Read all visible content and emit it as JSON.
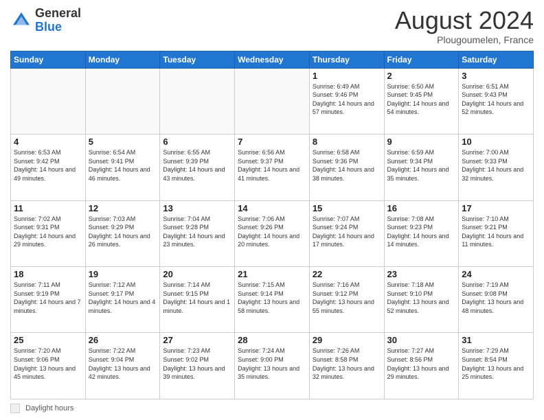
{
  "header": {
    "logo_general": "General",
    "logo_blue": "Blue",
    "month_title": "August 2024",
    "location": "Plougoumelen, France"
  },
  "legend": {
    "box_label": "Daylight hours"
  },
  "days_of_week": [
    "Sunday",
    "Monday",
    "Tuesday",
    "Wednesday",
    "Thursday",
    "Friday",
    "Saturday"
  ],
  "weeks": [
    [
      {
        "day": "",
        "info": ""
      },
      {
        "day": "",
        "info": ""
      },
      {
        "day": "",
        "info": ""
      },
      {
        "day": "",
        "info": ""
      },
      {
        "day": "1",
        "info": "Sunrise: 6:49 AM\nSunset: 9:46 PM\nDaylight: 14 hours\nand 57 minutes."
      },
      {
        "day": "2",
        "info": "Sunrise: 6:50 AM\nSunset: 9:45 PM\nDaylight: 14 hours\nand 54 minutes."
      },
      {
        "day": "3",
        "info": "Sunrise: 6:51 AM\nSunset: 9:43 PM\nDaylight: 14 hours\nand 52 minutes."
      }
    ],
    [
      {
        "day": "4",
        "info": "Sunrise: 6:53 AM\nSunset: 9:42 PM\nDaylight: 14 hours\nand 49 minutes."
      },
      {
        "day": "5",
        "info": "Sunrise: 6:54 AM\nSunset: 9:41 PM\nDaylight: 14 hours\nand 46 minutes."
      },
      {
        "day": "6",
        "info": "Sunrise: 6:55 AM\nSunset: 9:39 PM\nDaylight: 14 hours\nand 43 minutes."
      },
      {
        "day": "7",
        "info": "Sunrise: 6:56 AM\nSunset: 9:37 PM\nDaylight: 14 hours\nand 41 minutes."
      },
      {
        "day": "8",
        "info": "Sunrise: 6:58 AM\nSunset: 9:36 PM\nDaylight: 14 hours\nand 38 minutes."
      },
      {
        "day": "9",
        "info": "Sunrise: 6:59 AM\nSunset: 9:34 PM\nDaylight: 14 hours\nand 35 minutes."
      },
      {
        "day": "10",
        "info": "Sunrise: 7:00 AM\nSunset: 9:33 PM\nDaylight: 14 hours\nand 32 minutes."
      }
    ],
    [
      {
        "day": "11",
        "info": "Sunrise: 7:02 AM\nSunset: 9:31 PM\nDaylight: 14 hours\nand 29 minutes."
      },
      {
        "day": "12",
        "info": "Sunrise: 7:03 AM\nSunset: 9:29 PM\nDaylight: 14 hours\nand 26 minutes."
      },
      {
        "day": "13",
        "info": "Sunrise: 7:04 AM\nSunset: 9:28 PM\nDaylight: 14 hours\nand 23 minutes."
      },
      {
        "day": "14",
        "info": "Sunrise: 7:06 AM\nSunset: 9:26 PM\nDaylight: 14 hours\nand 20 minutes."
      },
      {
        "day": "15",
        "info": "Sunrise: 7:07 AM\nSunset: 9:24 PM\nDaylight: 14 hours\nand 17 minutes."
      },
      {
        "day": "16",
        "info": "Sunrise: 7:08 AM\nSunset: 9:23 PM\nDaylight: 14 hours\nand 14 minutes."
      },
      {
        "day": "17",
        "info": "Sunrise: 7:10 AM\nSunset: 9:21 PM\nDaylight: 14 hours\nand 11 minutes."
      }
    ],
    [
      {
        "day": "18",
        "info": "Sunrise: 7:11 AM\nSunset: 9:19 PM\nDaylight: 14 hours\nand 7 minutes."
      },
      {
        "day": "19",
        "info": "Sunrise: 7:12 AM\nSunset: 9:17 PM\nDaylight: 14 hours\nand 4 minutes."
      },
      {
        "day": "20",
        "info": "Sunrise: 7:14 AM\nSunset: 9:15 PM\nDaylight: 14 hours\nand 1 minute."
      },
      {
        "day": "21",
        "info": "Sunrise: 7:15 AM\nSunset: 9:14 PM\nDaylight: 13 hours\nand 58 minutes."
      },
      {
        "day": "22",
        "info": "Sunrise: 7:16 AM\nSunset: 9:12 PM\nDaylight: 13 hours\nand 55 minutes."
      },
      {
        "day": "23",
        "info": "Sunrise: 7:18 AM\nSunset: 9:10 PM\nDaylight: 13 hours\nand 52 minutes."
      },
      {
        "day": "24",
        "info": "Sunrise: 7:19 AM\nSunset: 9:08 PM\nDaylight: 13 hours\nand 48 minutes."
      }
    ],
    [
      {
        "day": "25",
        "info": "Sunrise: 7:20 AM\nSunset: 9:06 PM\nDaylight: 13 hours\nand 45 minutes."
      },
      {
        "day": "26",
        "info": "Sunrise: 7:22 AM\nSunset: 9:04 PM\nDaylight: 13 hours\nand 42 minutes."
      },
      {
        "day": "27",
        "info": "Sunrise: 7:23 AM\nSunset: 9:02 PM\nDaylight: 13 hours\nand 39 minutes."
      },
      {
        "day": "28",
        "info": "Sunrise: 7:24 AM\nSunset: 9:00 PM\nDaylight: 13 hours\nand 35 minutes."
      },
      {
        "day": "29",
        "info": "Sunrise: 7:26 AM\nSunset: 8:58 PM\nDaylight: 13 hours\nand 32 minutes."
      },
      {
        "day": "30",
        "info": "Sunrise: 7:27 AM\nSunset: 8:56 PM\nDaylight: 13 hours\nand 29 minutes."
      },
      {
        "day": "31",
        "info": "Sunrise: 7:29 AM\nSunset: 8:54 PM\nDaylight: 13 hours\nand 25 minutes."
      }
    ]
  ]
}
